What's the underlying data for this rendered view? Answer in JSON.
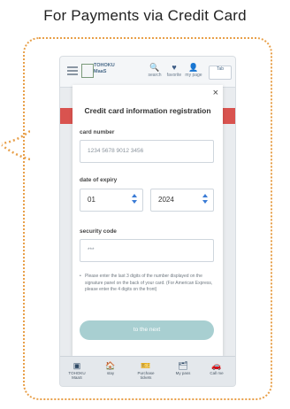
{
  "caption": "For Payments via Credit Card",
  "header": {
    "logo_line1": "TOHOKU",
    "logo_line2": "MaaS",
    "icons": [
      {
        "name": "search-icon",
        "glyph": "🔍",
        "label": "search"
      },
      {
        "name": "favorite-icon",
        "glyph": "♥",
        "label": "favorite"
      },
      {
        "name": "mypage-icon",
        "glyph": "👤",
        "label": "my page"
      }
    ],
    "button_label": "Tab"
  },
  "modal": {
    "close_glyph": "×",
    "title": "Credit card information registration",
    "card_number_label": "card number",
    "card_number_placeholder": "1234 5678 9012 3456",
    "expiry_label": "date of expiry",
    "expiry_month": "01",
    "expiry_year": "2024",
    "security_label": "security code",
    "security_placeholder": "***",
    "note_bullet": "•",
    "note": "Please enter the last 3 digits of the number displayed on the signature panel on the back of your card. (For American Express, please enter the 4 digits on the front)",
    "next_button": "to the next"
  },
  "bottom_nav": [
    {
      "name": "nav-home",
      "glyph": "▣",
      "label": "TOHOKU MaaS"
    },
    {
      "name": "nav-stay",
      "glyph": "🏠",
      "label": "stay"
    },
    {
      "name": "nav-purchase",
      "glyph": "🎫",
      "label": "Purchase tickets"
    },
    {
      "name": "nav-mypass",
      "glyph": "🗂",
      "label": "My pass"
    },
    {
      "name": "nav-callme",
      "glyph": "🚗",
      "label": "Call me"
    }
  ],
  "colors": {
    "frame": "#e8a04a",
    "accent_red": "#d9534f",
    "next_button": "#a8cfd1",
    "chevron": "#3a7bd5"
  }
}
